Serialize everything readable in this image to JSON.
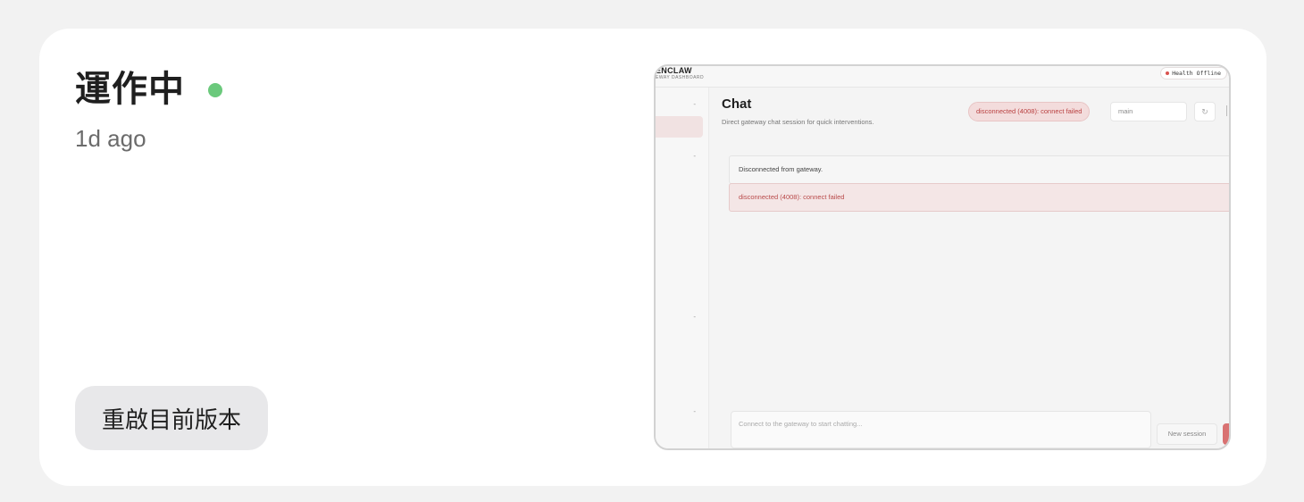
{
  "status": {
    "title": "運作中",
    "dot_color": "#6bc97c",
    "subtitle": "1d ago"
  },
  "actions": {
    "restart_label": "重啟目前版本"
  },
  "preview": {
    "brand": "ENCLAW",
    "brand_sub": "EWAY DASHBOARD",
    "health": "Health Offline",
    "chat_title": "Chat",
    "chat_description": "Direct gateway chat session for quick interventions.",
    "status_badge": "disconnected (4008): connect failed",
    "session_value": "main",
    "refresh_icon": "refresh-icon",
    "messages": [
      {
        "kind": "info",
        "text": "Disconnected from gateway."
      },
      {
        "kind": "error",
        "text": "disconnected (4008): connect failed"
      }
    ],
    "input_placeholder": "Connect to the gateway to start chatting...",
    "new_session_label": "New session",
    "sidebar_dashes": [
      "-",
      "-",
      "-",
      "-"
    ]
  }
}
